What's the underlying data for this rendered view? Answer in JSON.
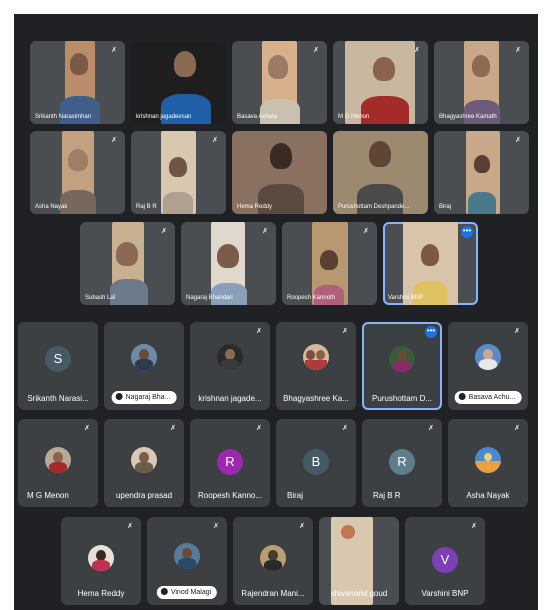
{
  "top_grid": {
    "row1": [
      {
        "name": "Srikanth Narasimhan",
        "muted": true
      },
      {
        "name": "krishnan jagadeesan",
        "muted": false
      },
      {
        "name": "Basava Achuta",
        "muted": true
      },
      {
        "name": "M G Menon",
        "muted": true
      },
      {
        "name": "Bhagyashree Kamath",
        "muted": true
      }
    ],
    "row2": [
      {
        "name": "Asha Nayak",
        "muted": true
      },
      {
        "name": "Raj B R",
        "muted": true
      },
      {
        "name": "Hema Reddy",
        "muted": false
      },
      {
        "name": "Purushottam Deshpande...",
        "muted": false
      },
      {
        "name": "Biraj",
        "muted": true
      }
    ],
    "row3": [
      {
        "name": "Subash Lal",
        "muted": true
      },
      {
        "name": "Nagaraj Bhandari",
        "muted": true
      },
      {
        "name": "Roopesh Kannoth",
        "muted": true
      },
      {
        "name": "Varshini BNP",
        "muted": false,
        "more": "•••"
      }
    ]
  },
  "bottom_grid": {
    "row1": [
      {
        "name": "Srikanth Narasi...",
        "initial": "S",
        "avatar_color": "#455a64",
        "muted": false
      },
      {
        "name": "Nagaraj Bha...",
        "pill": true,
        "muted": false
      },
      {
        "name": "krishnan jagade...",
        "muted": true
      },
      {
        "name": "Bhagyashree Ka...",
        "muted": true
      },
      {
        "name": "Purushottam D...",
        "muted": false,
        "more": "•••"
      },
      {
        "name": "Basava Achu...",
        "pill": true,
        "muted": true
      }
    ],
    "row2": [
      {
        "name": "M G Menon",
        "muted": true
      },
      {
        "name": "upendra prasad",
        "muted": true
      },
      {
        "name": "Roopesh Kanno...",
        "initial": "R",
        "avatar_color": "#9c27b0",
        "muted": true
      },
      {
        "name": "Biraj",
        "initial": "B",
        "avatar_color": "#455a64",
        "muted": true
      },
      {
        "name": "Raj B R",
        "initial": "R",
        "avatar_color": "#607d8b",
        "muted": true
      },
      {
        "name": "Asha Nayak",
        "muted": true
      }
    ],
    "row3": [
      {
        "name": "Hema Reddy",
        "muted": true
      },
      {
        "name": "Vinod Malagi",
        "pill": true,
        "muted": true
      },
      {
        "name": "Rajendran Mani...",
        "muted": true
      },
      {
        "name": "shivanand goud",
        "muted": false
      },
      {
        "name": "Varshini BNP",
        "initial": "V",
        "avatar_color": "#7b3fb6",
        "muted": true
      }
    ]
  },
  "icons": {
    "mute": "mic-off-icon",
    "more": "more-options-icon"
  },
  "colors": {
    "background": "#202124",
    "tile": "#3c4043",
    "active_border": "#8ab4f8",
    "more_button": "#1a73e8"
  }
}
